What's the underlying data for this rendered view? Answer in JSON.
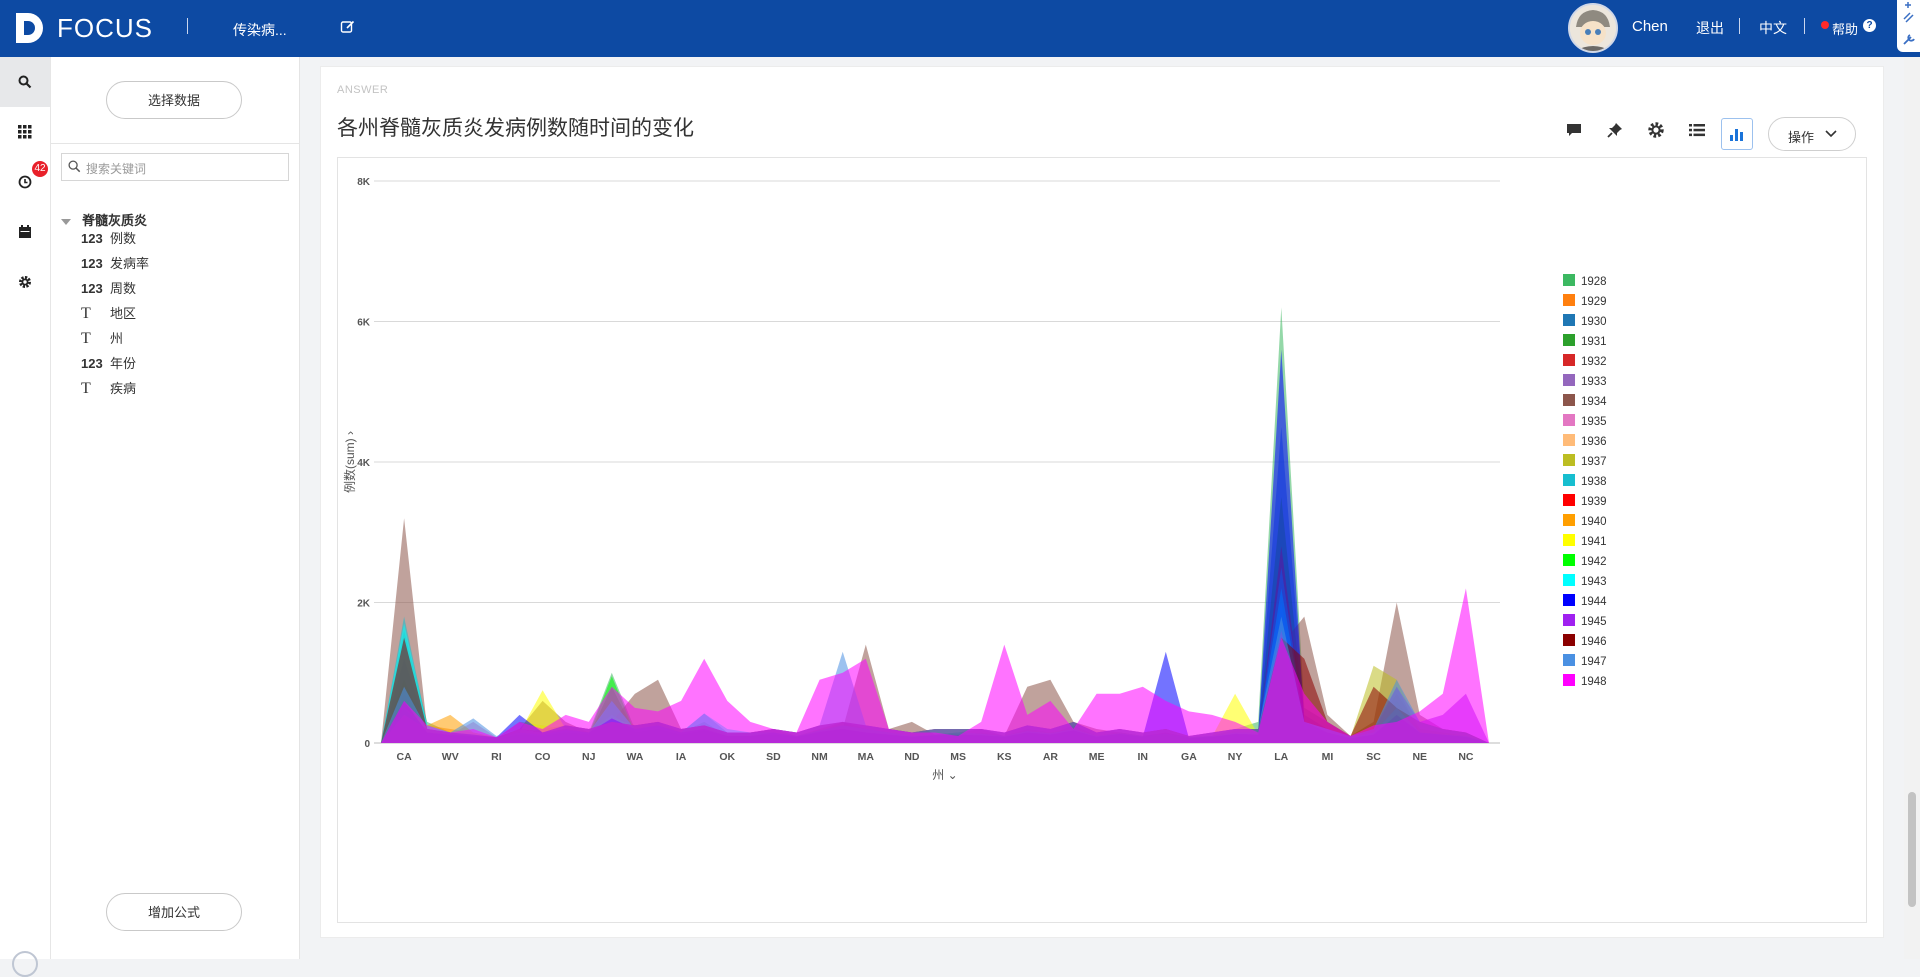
{
  "header": {
    "brand": "FOCUS",
    "tab_name": "传染病...",
    "user_name": "Chen",
    "logout": "退出",
    "language": "中文",
    "help": "帮助",
    "help_symbol": "?"
  },
  "rail": {
    "history_badge": "42"
  },
  "data_panel": {
    "select_data": "选择数据",
    "search_placeholder": "搜索关键词",
    "table_name": "脊髓灰质炎",
    "fields": [
      {
        "type": "123",
        "name": "例数"
      },
      {
        "type": "123",
        "name": "发病率"
      },
      {
        "type": "123",
        "name": "周数"
      },
      {
        "type": "T",
        "name": "地区"
      },
      {
        "type": "T",
        "name": "州"
      },
      {
        "type": "123",
        "name": "年份"
      },
      {
        "type": "T",
        "name": "疾病"
      }
    ],
    "add_formula": "增加公式"
  },
  "main": {
    "answer_label": "ANSWER",
    "title": "各州脊髓灰质炎发病例数随时间的变化",
    "operate": "操作"
  },
  "chart_data": {
    "type": "area",
    "ylabel": "例数(sum)",
    "xlabel": "州",
    "ylim": [
      0,
      8000
    ],
    "yticks": [
      "0",
      "2K",
      "4K",
      "6K",
      "8K"
    ],
    "x_labeled": [
      "CA",
      "WV",
      "RI",
      "CO",
      "NJ",
      "WA",
      "IA",
      "OK",
      "SD",
      "NM",
      "MA",
      "ND",
      "MS",
      "KS",
      "AR",
      "ME",
      "IN",
      "GA",
      "NY",
      "LA",
      "MI",
      "SC",
      "NE",
      "NC"
    ],
    "n_points": 49,
    "legend_position": "right",
    "grid": true,
    "series": [
      {
        "name": "1928",
        "color": "#3cb861",
        "values": [
          0,
          1600,
          300,
          150,
          100,
          50,
          150,
          200,
          250,
          150,
          1000,
          200,
          250,
          150,
          300,
          100,
          100,
          100,
          50,
          150,
          300,
          200,
          150,
          100,
          100,
          100,
          150,
          100,
          200,
          150,
          200,
          100,
          150,
          100,
          120,
          80,
          100,
          200,
          300,
          6200,
          500,
          300,
          100,
          120,
          500,
          200,
          150,
          100,
          0
        ]
      },
      {
        "name": "1929",
        "color": "#ff7f0e",
        "values": [
          0,
          800,
          250,
          200,
          150,
          80,
          200,
          120,
          250,
          100,
          400,
          250,
          300,
          150,
          200,
          80,
          100,
          150,
          100,
          200,
          300,
          150,
          150,
          80,
          100,
          150,
          100,
          80,
          150,
          100,
          200,
          100,
          150,
          100,
          150,
          80,
          100,
          150,
          100,
          600,
          300,
          150,
          80,
          200,
          700,
          200,
          150,
          100,
          0
        ]
      },
      {
        "name": "1930",
        "color": "#1f77b4",
        "values": [
          0,
          1200,
          200,
          150,
          100,
          60,
          150,
          150,
          200,
          120,
          600,
          200,
          250,
          120,
          250,
          100,
          100,
          120,
          80,
          150,
          250,
          180,
          150,
          90,
          120,
          120,
          120,
          90,
          180,
          120,
          250,
          100,
          150,
          100,
          120,
          80,
          100,
          180,
          200,
          4500,
          400,
          200,
          80,
          150,
          800,
          150,
          120,
          100,
          0
        ]
      },
      {
        "name": "1931",
        "color": "#2ca02c",
        "values": [
          0,
          900,
          150,
          100,
          80,
          50,
          120,
          120,
          180,
          100,
          800,
          150,
          200,
          100,
          180,
          80,
          80,
          100,
          60,
          120,
          200,
          120,
          100,
          80,
          100,
          100,
          100,
          80,
          150,
          100,
          180,
          80,
          120,
          80,
          100,
          60,
          80,
          150,
          150,
          3500,
          300,
          150,
          60,
          100,
          600,
          120,
          100,
          80,
          0
        ]
      },
      {
        "name": "1932",
        "color": "#d62728",
        "values": [
          0,
          700,
          180,
          120,
          100,
          60,
          140,
          100,
          160,
          120,
          300,
          200,
          250,
          120,
          200,
          100,
          100,
          120,
          90,
          160,
          200,
          150,
          120,
          100,
          120,
          120,
          110,
          90,
          160,
          120,
          180,
          100,
          130,
          90,
          110,
          70,
          90,
          130,
          120,
          2800,
          250,
          150,
          70,
          120,
          500,
          150,
          120,
          90,
          0
        ]
      },
      {
        "name": "1933",
        "color": "#9467bd",
        "values": [
          0,
          600,
          150,
          100,
          80,
          50,
          100,
          90,
          150,
          100,
          400,
          150,
          200,
          100,
          150,
          80,
          80,
          100,
          70,
          130,
          180,
          120,
          100,
          80,
          100,
          100,
          100,
          80,
          140,
          100,
          160,
          80,
          110,
          80,
          100,
          60,
          80,
          120,
          110,
          2000,
          200,
          120,
          60,
          100,
          400,
          120,
          100,
          80,
          0
        ]
      },
      {
        "name": "1934",
        "color": "#8c564b",
        "values": [
          0,
          3200,
          200,
          150,
          120,
          80,
          200,
          600,
          300,
          150,
          300,
          700,
          900,
          200,
          250,
          120,
          150,
          200,
          100,
          150,
          200,
          1400,
          200,
          300,
          120,
          150,
          200,
          100,
          800,
          900,
          300,
          200,
          150,
          100,
          150,
          80,
          100,
          150,
          150,
          1400,
          1800,
          400,
          100,
          300,
          2000,
          400,
          200,
          150,
          0
        ]
      },
      {
        "name": "1935",
        "color": "#e377c2",
        "values": [
          0,
          500,
          150,
          120,
          300,
          80,
          150,
          100,
          150,
          120,
          300,
          200,
          250,
          150,
          200,
          100,
          100,
          150,
          90,
          160,
          200,
          150,
          120,
          90,
          110,
          120,
          110,
          90,
          150,
          120,
          180,
          90,
          130,
          90,
          110,
          70,
          90,
          130,
          120,
          1500,
          250,
          150,
          70,
          120,
          400,
          150,
          120,
          90,
          0
        ]
      },
      {
        "name": "1936",
        "color": "#ffbb78",
        "values": [
          0,
          400,
          120,
          100,
          80,
          60,
          120,
          100,
          150,
          100,
          250,
          150,
          200,
          100,
          150,
          80,
          80,
          120,
          70,
          140,
          180,
          120,
          100,
          80,
          100,
          100,
          100,
          80,
          130,
          100,
          160,
          80,
          110,
          80,
          100,
          60,
          80,
          110,
          100,
          1200,
          200,
          120,
          60,
          100,
          350,
          120,
          100,
          80,
          0
        ]
      },
      {
        "name": "1937",
        "color": "#bcbd22",
        "values": [
          0,
          600,
          180,
          150,
          120,
          70,
          300,
          250,
          200,
          150,
          350,
          250,
          300,
          150,
          250,
          100,
          120,
          150,
          100,
          180,
          250,
          200,
          150,
          100,
          120,
          150,
          120,
          100,
          180,
          150,
          220,
          100,
          150,
          100,
          130,
          80,
          100,
          150,
          150,
          1800,
          300,
          200,
          80,
          1100,
          900,
          200,
          150,
          100,
          0
        ]
      },
      {
        "name": "1938",
        "color": "#17becf",
        "values": [
          0,
          1800,
          250,
          150,
          120,
          70,
          180,
          150,
          200,
          150,
          400,
          200,
          250,
          150,
          420,
          150,
          150,
          150,
          100,
          180,
          250,
          200,
          150,
          100,
          120,
          150,
          130,
          100,
          170,
          140,
          200,
          100,
          140,
          100,
          130,
          80,
          100,
          150,
          150,
          2500,
          300,
          200,
          80,
          150,
          500,
          150,
          120,
          100,
          0
        ]
      },
      {
        "name": "1939",
        "color": "#ff0000",
        "values": [
          0,
          600,
          150,
          100,
          80,
          50,
          130,
          100,
          150,
          100,
          300,
          150,
          200,
          100,
          150,
          80,
          80,
          100,
          70,
          130,
          180,
          120,
          100,
          80,
          100,
          100,
          100,
          80,
          140,
          100,
          160,
          80,
          110,
          80,
          100,
          60,
          80,
          120,
          110,
          1600,
          200,
          120,
          60,
          100,
          400,
          120,
          100,
          80,
          0
        ]
      },
      {
        "name": "1940",
        "color": "#ff9f00",
        "values": [
          0,
          500,
          250,
          400,
          150,
          80,
          200,
          150,
          250,
          200,
          300,
          200,
          250,
          150,
          200,
          100,
          100,
          150,
          90,
          160,
          200,
          150,
          120,
          90,
          110,
          120,
          110,
          90,
          150,
          120,
          180,
          90,
          130,
          90,
          110,
          70,
          90,
          130,
          120,
          1400,
          250,
          150,
          70,
          120,
          300,
          150,
          120,
          90,
          0
        ]
      },
      {
        "name": "1941",
        "color": "#ffff00",
        "values": [
          0,
          400,
          150,
          120,
          100,
          60,
          150,
          750,
          200,
          150,
          250,
          150,
          200,
          120,
          180,
          100,
          100,
          120,
          80,
          150,
          200,
          150,
          120,
          90,
          110,
          120,
          110,
          90,
          150,
          120,
          180,
          90,
          120,
          90,
          110,
          70,
          90,
          700,
          120,
          1200,
          200,
          150,
          70,
          120,
          300,
          150,
          120,
          90,
          0
        ]
      },
      {
        "name": "1942",
        "color": "#00ff00",
        "values": [
          0,
          500,
          150,
          100,
          80,
          60,
          120,
          100,
          150,
          120,
          950,
          150,
          200,
          120,
          180,
          100,
          100,
          120,
          80,
          150,
          200,
          150,
          120,
          90,
          110,
          120,
          110,
          90,
          150,
          120,
          180,
          90,
          130,
          90,
          110,
          70,
          90,
          130,
          120,
          1300,
          250,
          150,
          70,
          120,
          350,
          150,
          120,
          90,
          0
        ]
      },
      {
        "name": "1943",
        "color": "#00ffff",
        "values": [
          0,
          1700,
          250,
          150,
          120,
          70,
          150,
          120,
          180,
          150,
          600,
          200,
          250,
          150,
          420,
          200,
          150,
          150,
          100,
          180,
          250,
          200,
          150,
          100,
          120,
          150,
          130,
          100,
          170,
          140,
          200,
          100,
          140,
          100,
          130,
          80,
          100,
          150,
          150,
          2200,
          300,
          200,
          80,
          150,
          500,
          150,
          120,
          100,
          0
        ]
      },
      {
        "name": "1944",
        "color": "#0000ff",
        "values": [
          0,
          600,
          150,
          120,
          100,
          80,
          400,
          150,
          200,
          150,
          350,
          200,
          250,
          150,
          200,
          100,
          100,
          150,
          90,
          160,
          200,
          150,
          120,
          90,
          110,
          120,
          110,
          90,
          150,
          120,
          180,
          90,
          130,
          90,
          1300,
          70,
          90,
          130,
          120,
          5600,
          300,
          150,
          70,
          120,
          400,
          150,
          120,
          90,
          0
        ]
      },
      {
        "name": "1945",
        "color": "#a020f0",
        "values": [
          0,
          400,
          200,
          150,
          120,
          80,
          200,
          150,
          250,
          200,
          300,
          250,
          300,
          200,
          250,
          150,
          150,
          200,
          150,
          250,
          300,
          250,
          200,
          150,
          200,
          200,
          200,
          150,
          250,
          200,
          300,
          150,
          200,
          150,
          200,
          100,
          150,
          200,
          200,
          1600,
          300,
          200,
          100,
          200,
          800,
          300,
          400,
          700,
          0
        ]
      },
      {
        "name": "1946",
        "color": "#8b0000",
        "values": [
          0,
          1500,
          200,
          150,
          120,
          80,
          200,
          150,
          250,
          200,
          300,
          250,
          300,
          200,
          250,
          150,
          150,
          200,
          150,
          250,
          300,
          250,
          200,
          150,
          200,
          200,
          200,
          150,
          250,
          200,
          300,
          150,
          200,
          150,
          200,
          100,
          150,
          200,
          200,
          1500,
          1200,
          300,
          100,
          800,
          500,
          300,
          200,
          150,
          0
        ]
      },
      {
        "name": "1947",
        "color": "#4a90e2",
        "values": [
          0,
          800,
          200,
          150,
          350,
          100,
          200,
          150,
          250,
          200,
          300,
          250,
          300,
          200,
          250,
          150,
          150,
          200,
          150,
          250,
          1300,
          250,
          200,
          150,
          200,
          200,
          200,
          150,
          250,
          200,
          300,
          150,
          200,
          150,
          200,
          100,
          150,
          200,
          200,
          1800,
          300,
          200,
          100,
          200,
          900,
          300,
          200,
          150,
          0
        ]
      },
      {
        "name": "1948",
        "color": "#ff00ff",
        "values": [
          0,
          600,
          250,
          150,
          200,
          80,
          300,
          200,
          400,
          300,
          800,
          500,
          450,
          600,
          1200,
          600,
          300,
          200,
          150,
          900,
          1000,
          1200,
          200,
          150,
          150,
          100,
          300,
          1400,
          400,
          600,
          200,
          700,
          700,
          800,
          600,
          450,
          400,
          300,
          150,
          1500,
          700,
          300,
          100,
          250,
          300,
          450,
          700,
          2200,
          0
        ]
      }
    ]
  }
}
